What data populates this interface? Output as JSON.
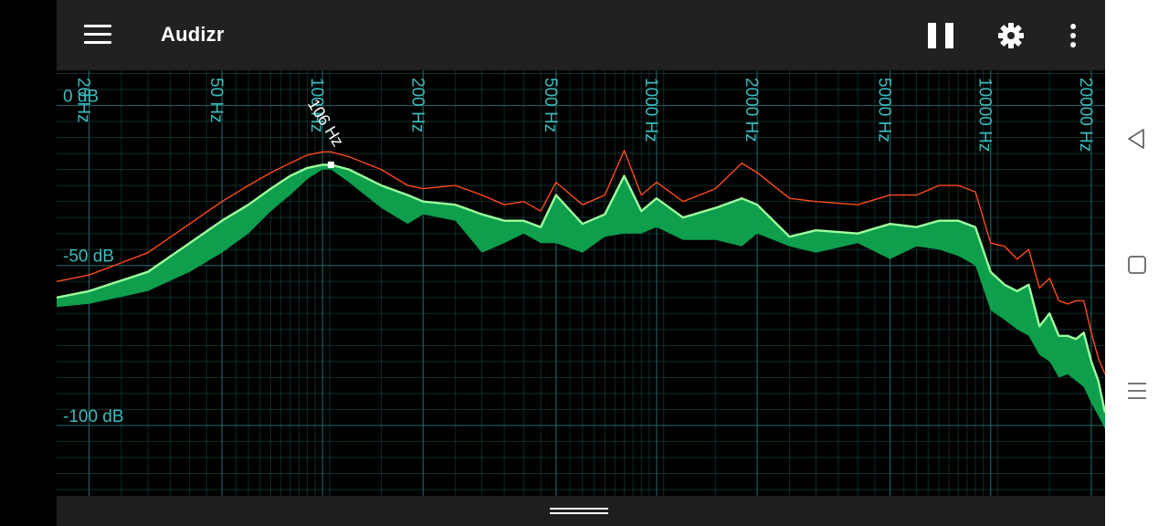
{
  "app": {
    "title": "Audizr"
  },
  "toolbar": {
    "menu_icon": "hamburger-menu-icon",
    "pause_icon": "pause-icon",
    "settings_icon": "gear-icon",
    "more_icon": "more-vertical-icon"
  },
  "spectrum": {
    "freq_labels": [
      "20 Hz",
      "50 Hz",
      "100 Hz",
      "200 Hz",
      "500 Hz",
      "1000 Hz",
      "2000 Hz",
      "5000 Hz",
      "10000 Hz",
      "20000 Hz"
    ],
    "db_labels": [
      "0 dB",
      "-50 dB",
      "-100 dB"
    ],
    "marker_label": "106 Hz",
    "colors": {
      "background": "#000000",
      "grid": "#1f5c5c",
      "label": "#3cbcbc",
      "peak": "#ff4a1c",
      "current": "#9dff9d",
      "fill": "#0fa650"
    }
  },
  "chart_data": {
    "type": "line",
    "title": "",
    "xlabel": "",
    "ylabel": "",
    "x_scale": "log",
    "xlim": [
      16,
      22000
    ],
    "ylim": [
      -122,
      11
    ],
    "x_ticks": [
      20,
      50,
      100,
      200,
      500,
      1000,
      2000,
      5000,
      10000,
      20000
    ],
    "y_ticks": [
      0,
      -50,
      -100
    ],
    "grid": true,
    "marker": {
      "x": 106,
      "y": -18.5,
      "label": "106 Hz"
    },
    "x": [
      16,
      20,
      30,
      40,
      50,
      60,
      70,
      80,
      90,
      100,
      106,
      120,
      150,
      180,
      200,
      250,
      300,
      350,
      400,
      450,
      500,
      600,
      700,
      800,
      900,
      1000,
      1200,
      1500,
      1800,
      2000,
      2500,
      3000,
      4000,
      5000,
      6000,
      7000,
      8000,
      9000,
      10000,
      11000,
      12000,
      13000,
      14000,
      15000,
      16000,
      17000,
      18000,
      19000,
      20000,
      21000,
      22000
    ],
    "series": [
      {
        "name": "",
        "role": "peak",
        "values": [
          -55,
          -53,
          -46,
          -37,
          -30,
          -25,
          -21,
          -18,
          -15.5,
          -14.5,
          -14.5,
          -16,
          -20,
          -25,
          -26,
          -25,
          -28,
          -31,
          -30,
          -33,
          -24,
          -31,
          -28,
          -14,
          -28,
          -24,
          -30,
          -26,
          -18,
          -21,
          -29,
          -30,
          -31,
          -28,
          -28,
          -25,
          -25,
          -27,
          -43,
          -44,
          -48,
          -45,
          -57,
          -54,
          -61,
          -62,
          -61,
          -61,
          -71,
          -79,
          -84
        ]
      },
      {
        "name": "",
        "role": "current",
        "values": [
          -60,
          -58,
          -52,
          -43,
          -36,
          -31,
          -26,
          -22,
          -19.5,
          -18.5,
          -18.5,
          -20,
          -25,
          -28,
          -30,
          -31,
          -34,
          -36,
          -36,
          -38,
          -28,
          -37,
          -34,
          -22,
          -33,
          -29,
          -35,
          -32,
          -29,
          -31,
          -41,
          -39,
          -40,
          -37,
          -38,
          -36,
          -36,
          -38,
          -52,
          -56,
          -58,
          -56,
          -69,
          -65,
          -72,
          -72,
          -73,
          -71,
          -80,
          -86,
          -96
        ]
      },
      {
        "name": "",
        "role": "range-low",
        "values": [
          -63,
          -62,
          -58,
          -52,
          -46,
          -40,
          -33,
          -28,
          -23,
          -20,
          -20,
          -24,
          -32,
          -37,
          -34,
          -36,
          -46,
          -43,
          -40,
          -43,
          -43,
          -46,
          -41,
          -40,
          -40,
          -38,
          -42,
          -42,
          -44,
          -40,
          -44,
          -46,
          -43,
          -48,
          -44,
          -45,
          -47,
          -50,
          -64,
          -67,
          -70,
          -72,
          -78,
          -80,
          -85,
          -84,
          -86,
          -88,
          -93,
          -97,
          -101
        ]
      }
    ]
  }
}
